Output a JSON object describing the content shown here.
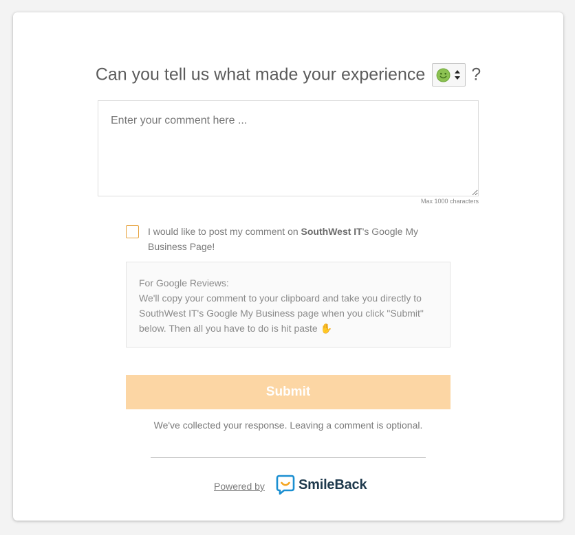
{
  "question": {
    "text": "Can you tell us what made your experience",
    "selected_mood_icon": "smiley-face-icon",
    "question_mark": "?"
  },
  "comment": {
    "placeholder": "Enter your comment here ...",
    "value": "",
    "max_label": "Max 1000 characters"
  },
  "consent": {
    "prefix": "I would like to post my comment on ",
    "company": "SouthWest IT",
    "suffix": "'s Google My Business Page!",
    "checked": false
  },
  "google_info": {
    "heading": "For Google Reviews:",
    "body": "We'll copy your comment to your clipboard and take you directly to SouthWest IT's Google My Business page when you click \"Submit\" below. Then all you have to do is hit paste",
    "emoji": "✋"
  },
  "submit_label": "Submit",
  "collected_message": "We've collected your response. Leaving a comment is optional.",
  "footer": {
    "powered_by": "Powered by",
    "brand": "SmileBack"
  },
  "colors": {
    "accent": "#fcd6a4",
    "checkbox_border": "#e6a23c",
    "smiley_green": "#8cc152",
    "brand_blue": "#1b8fd1",
    "brand_yellow": "#f5a623"
  }
}
